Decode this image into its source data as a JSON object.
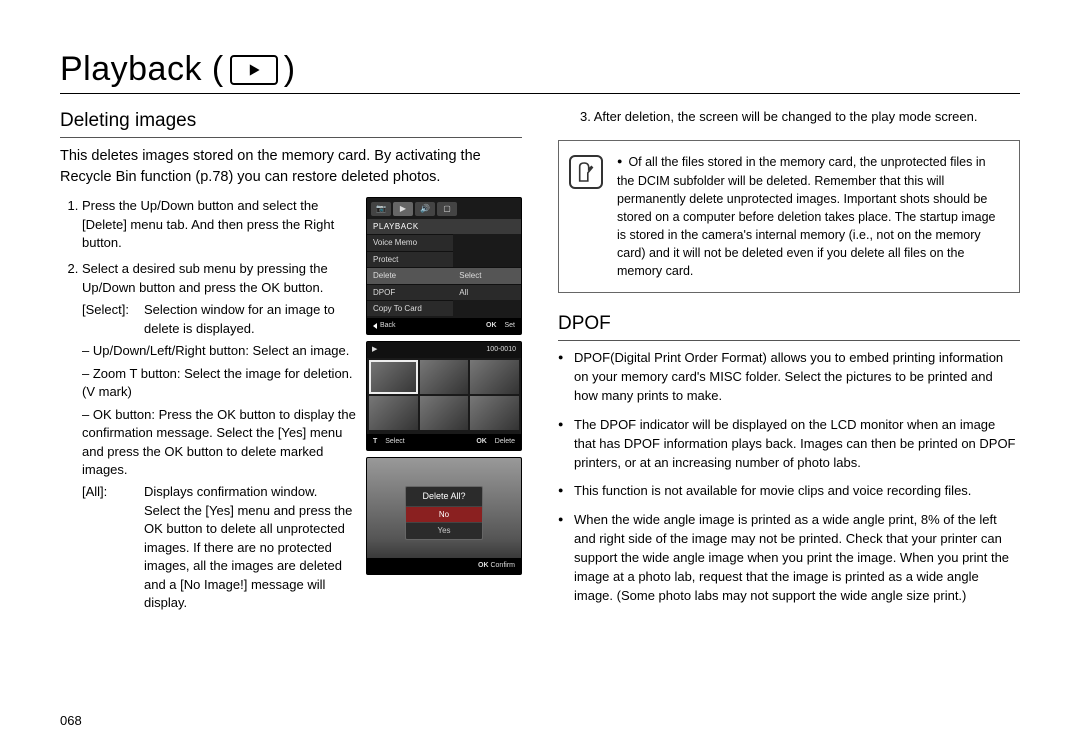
{
  "page_number": "068",
  "title_prefix": "Playback (",
  "title_suffix": ")",
  "left": {
    "heading": "Deleting images",
    "intro": "This deletes images stored on the memory card. By activating the Recycle Bin function (p.78) you can restore deleted photos.",
    "step1": "Press the Up/Down button and select the [Delete] menu tab. And then press the Right button.",
    "step2": "Select a desired sub menu by pressing the Up/Down button and press the OK button.",
    "select_key": "[Select]:",
    "select_val": "Selection window for an image to delete is displayed.",
    "sub_updown": "– Up/Down/Left/Right button: Select an image.",
    "sub_zoom": "– Zoom T button: Select the image for deletion. (V mark)",
    "sub_ok": "– OK button: Press the OK button to display the confirmation message. Select the [Yes] menu and press the OK button to delete marked images.",
    "all_key": "[All]:",
    "all_val": "Displays confirmation window. Select the [Yes] menu and press the OK button to delete all unprotected images. If there are no protected images, all the images are deleted and a [No Image!] message will display.",
    "overflow": ""
  },
  "lcd1": {
    "header": "PLAYBACK",
    "items": [
      "Voice Memo",
      "Protect",
      "Delete",
      "DPOF",
      "Copy To Card"
    ],
    "sub": [
      "Select",
      "All"
    ],
    "back": "Back",
    "set": "Set",
    "ok": "OK"
  },
  "lcd2": {
    "counter": "100-0010",
    "t": "T",
    "select": "Select",
    "ok": "OK",
    "delete": "Delete"
  },
  "lcd3": {
    "question": "Delete All?",
    "no": "No",
    "yes": "Yes",
    "ok": "OK",
    "confirm": "Confirm"
  },
  "right": {
    "step3": "3. After deletion, the screen will be changed to the play mode screen.",
    "note": "Of all the files stored in the memory card, the unprotected files in the DCIM subfolder will be deleted. Remember that this will permanently delete unprotected images. Important shots should be stored on a computer before deletion takes place. The startup image is stored in the camera's internal memory (i.e., not on the memory card) and it will not be deleted even if you delete all files on the memory card.",
    "dpof_heading": "DPOF",
    "b1": "DPOF(Digital Print Order Format) allows you to embed printing information on your memory card's MISC folder. Select the pictures to be printed and how many prints to make.",
    "b2": "The DPOF indicator will be displayed on the LCD monitor when an image that has DPOF information plays back. Images can then be printed on DPOF printers, or at an increasing number of photo labs.",
    "b3": "This function is not available for movie clips and voice recording files.",
    "b4": "When the wide angle image is printed as a wide angle print, 8% of the left and right side of the image may not be printed. Check that your printer can support the wide angle image when you print the image. When you print the image at a photo lab, request that the image is printed as a wide angle image. (Some photo labs may not support the wide angle size print.)"
  }
}
